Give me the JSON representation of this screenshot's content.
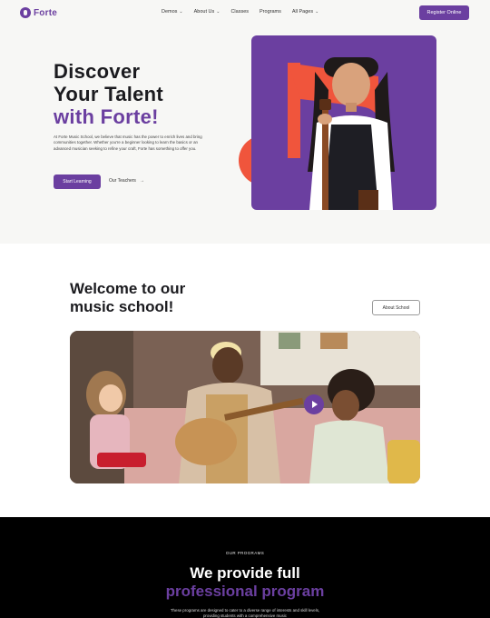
{
  "brand": {
    "name": "Forte",
    "accent": "#6b3fa0",
    "highlight": "#f0553c"
  },
  "nav": {
    "items": [
      {
        "label": "Demos",
        "dropdown": true
      },
      {
        "label": "About Us",
        "dropdown": true
      },
      {
        "label": "Classes",
        "dropdown": false
      },
      {
        "label": "Programs",
        "dropdown": false
      },
      {
        "label": "All Pages",
        "dropdown": true
      }
    ],
    "register_label": "Register Online"
  },
  "hero": {
    "title_line1": "Discover",
    "title_line2": "Your Talent",
    "title_line3": "with Forte!",
    "description": "At Forte Music School, we believe that music has the power to enrich lives and bring communities together. Whether you're a beginner looking to learn the basics or an advanced musician seeking to refine your craft, Forte has something to offer you.",
    "start_label": "Start Learning",
    "teachers_label": "Our Teachers"
  },
  "welcome": {
    "title_line1": "Welcome to our",
    "title_line2": "music school!",
    "about_label": "About School"
  },
  "programs": {
    "eyebrow": "OUR PROGRAMS",
    "title_line1": "We provide full",
    "title_line2": "professional program",
    "description": "These programs are designed to cater to a diverse range of interests and skill levels, providing students with a comprehensive music"
  }
}
